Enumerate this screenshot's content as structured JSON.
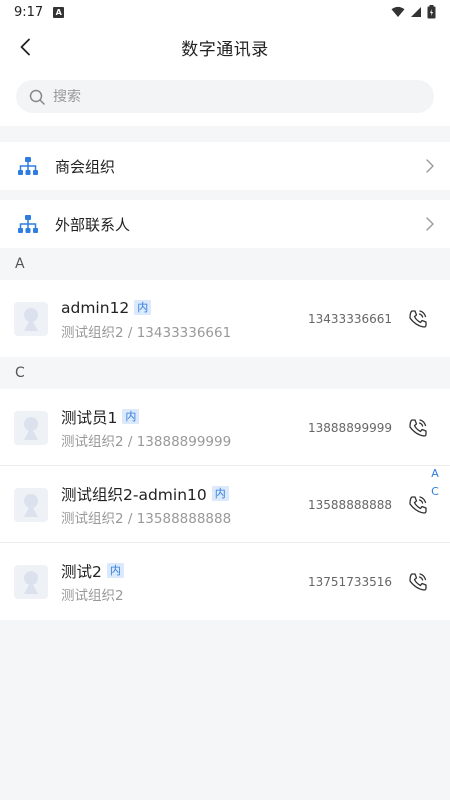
{
  "status_bar": {
    "time": "9:17",
    "indicator": "A"
  },
  "header": {
    "title": "数字通讯录"
  },
  "search": {
    "placeholder": "搜索",
    "value": ""
  },
  "nav": [
    {
      "label": "商会组织",
      "icon": "org-tree-icon"
    },
    {
      "label": "外部联系人",
      "icon": "org-tree-icon"
    }
  ],
  "sections": [
    {
      "letter": "A",
      "contacts": [
        {
          "name": "admin12",
          "badge": "内",
          "sub": "测试组织2 / 13433336661",
          "phone": "13433336661"
        }
      ]
    },
    {
      "letter": "C",
      "contacts": [
        {
          "name": "测试员1",
          "badge": "内",
          "sub": "测试组织2 / 13888899999",
          "phone": "13888899999"
        },
        {
          "name": "测试组织2-admin10",
          "badge": "内",
          "sub": "测试组织2 / 13588888888",
          "phone": "13588888888"
        },
        {
          "name": "测试2",
          "badge": "内",
          "sub": "测试组织2",
          "phone": "13751733516"
        }
      ]
    }
  ],
  "index_bar": [
    "A",
    "C"
  ],
  "colors": {
    "accent": "#2f7de1",
    "badge_bg": "#dbe9fb",
    "background": "#f5f6f8"
  }
}
